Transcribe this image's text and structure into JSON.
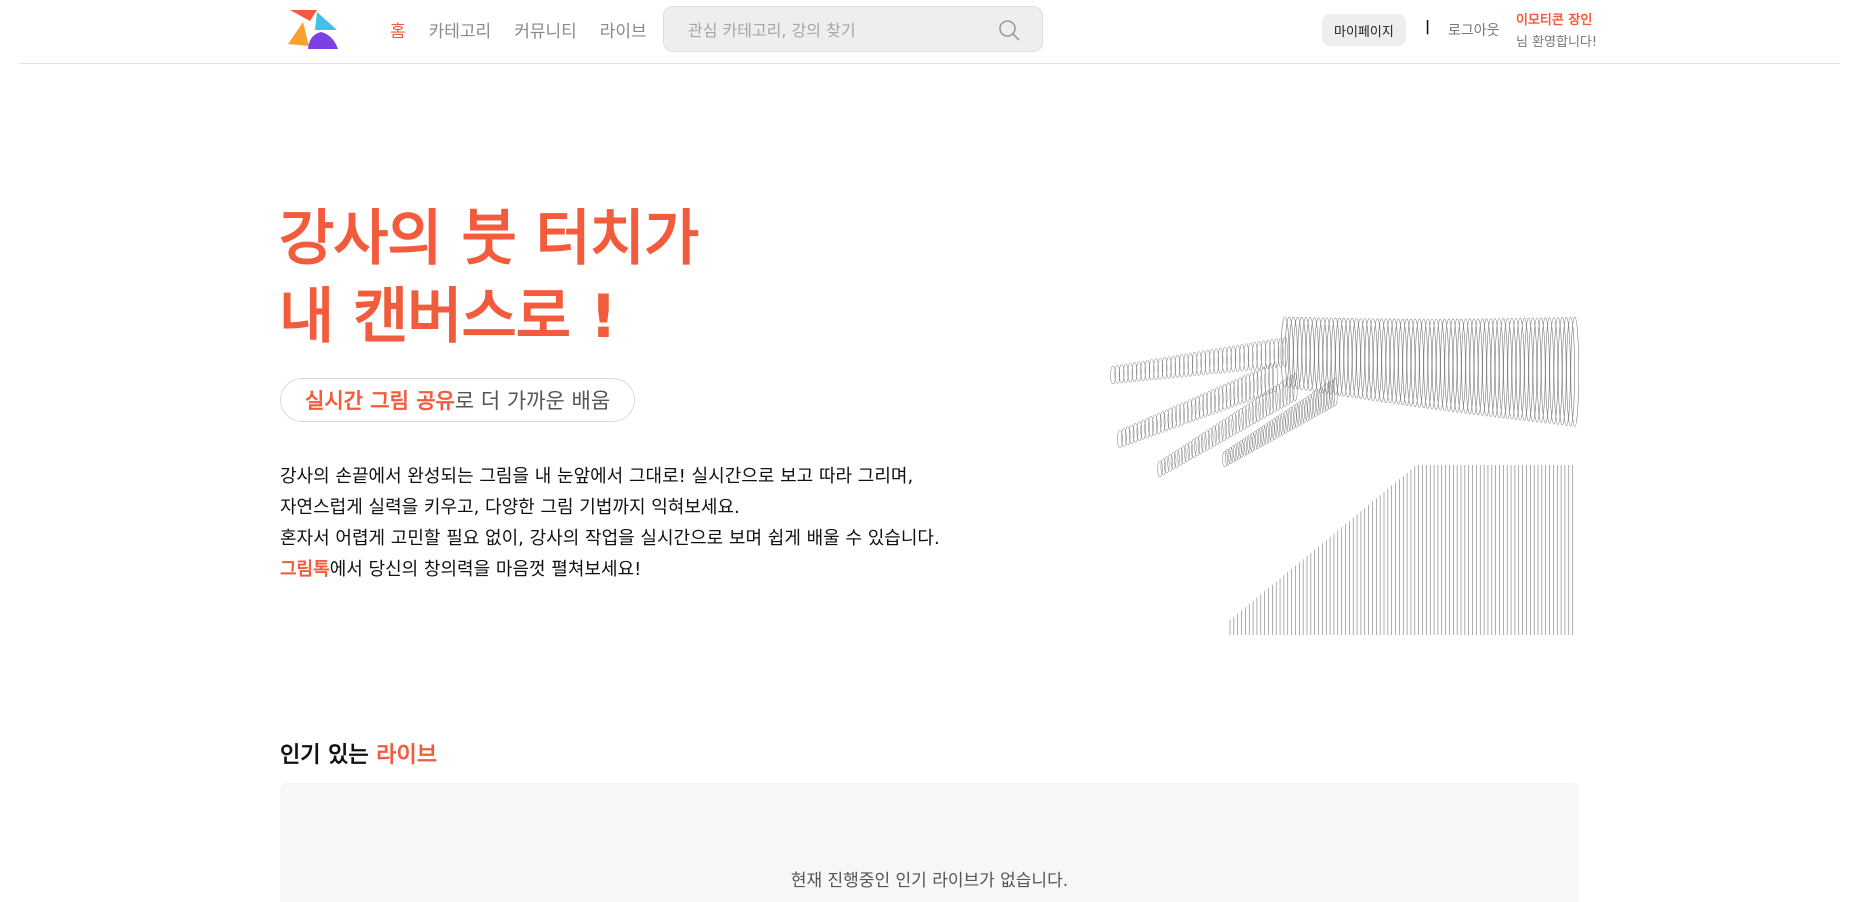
{
  "header": {
    "logo_name": "app-logo",
    "nav": [
      {
        "label": "홈",
        "active": true
      },
      {
        "label": "카테고리",
        "active": false
      },
      {
        "label": "커뮤니티",
        "active": false
      },
      {
        "label": "라이브",
        "active": false
      }
    ],
    "search": {
      "placeholder": "관심 카테고리, 강의 찾기",
      "value": "",
      "icon": "search-icon"
    },
    "mypage_label": "마이페이지",
    "separator": "|",
    "logout_label": "로그아웃",
    "user_name": "이모티콘 장인",
    "welcome_suffix": "님 환영합니다!"
  },
  "hero": {
    "title_line1": "강사의 붓 터치가",
    "title_line2": "내 캔버스로 !",
    "pill_highlight": "실시간 그림 공유",
    "pill_rest": "로 더 가까운 배움",
    "desc_lines": [
      "강사의 손끝에서 완성되는 그림을 내 눈앞에서 그대로! 실시간으로 보고 따라 그리며,",
      "자연스럽게 실력을 키우고, 다양한 그림 기법까지 익혀보세요.",
      "혼자서 어렵게 고민할 필요 없이, 강사의 작업을 실시간으로 보며 쉽게 배울 수 있습니다."
    ],
    "desc_last_highlight": "그림톡",
    "desc_last_rest": "에서 당신의 창의력을 마음껏 펼쳐보세요!",
    "illustration": "hand-drawing-illustration"
  },
  "popular_live": {
    "title_prefix": "인기 있는",
    "title_highlight": "라이브",
    "empty_message": "현재 진행중인 인기 라이브가 없습니다."
  },
  "colors": {
    "accent": "#f25c3c",
    "muted": "#8a8a8a",
    "panel": "#f7f7f7"
  }
}
